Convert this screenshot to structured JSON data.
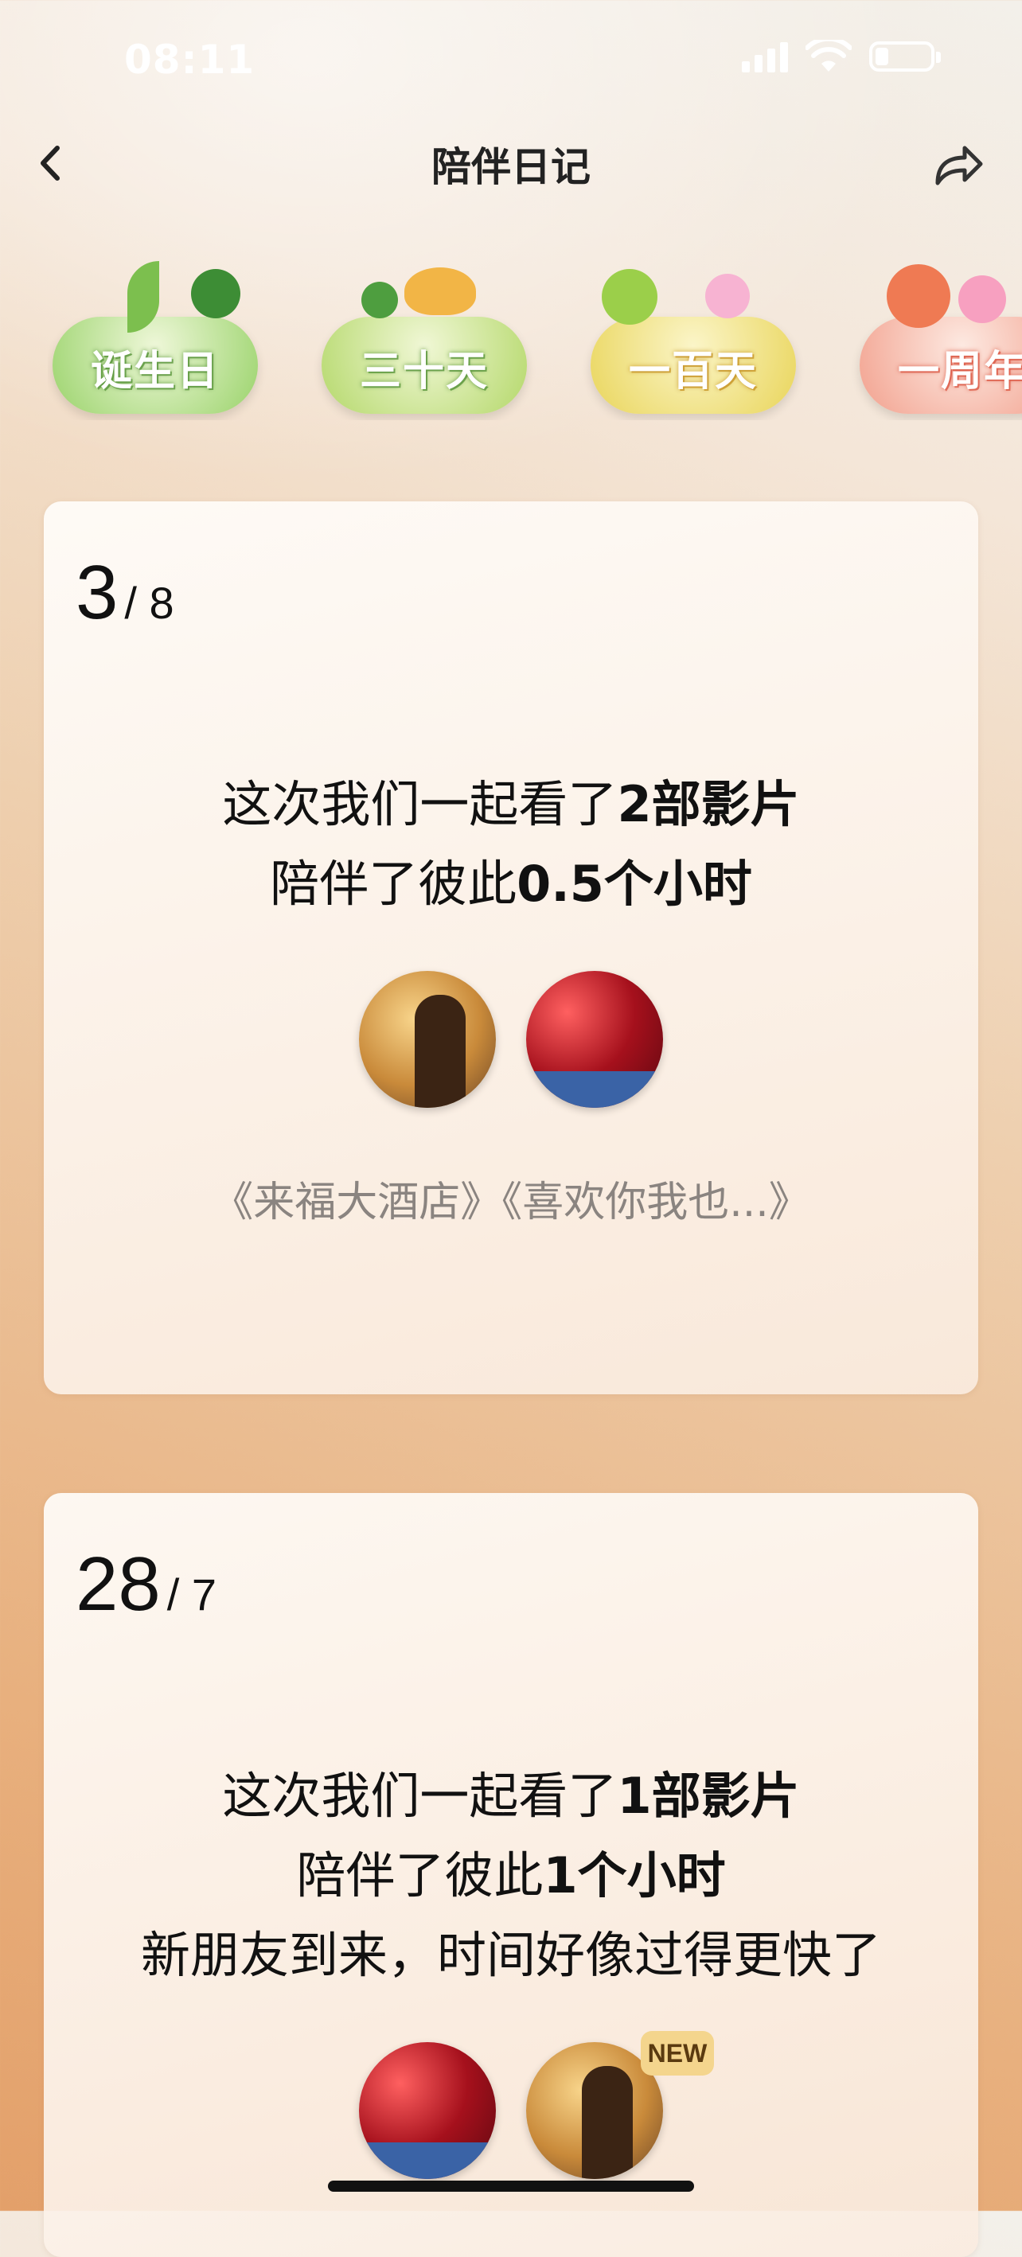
{
  "status_bar": {
    "time": "08:11"
  },
  "header": {
    "title": "陪伴日记"
  },
  "milestones": [
    {
      "label": "诞生日",
      "color": "#9ad36b"
    },
    {
      "label": "三十天",
      "color": "#b4d86a"
    },
    {
      "label": "一百天",
      "color": "#e9d55a"
    },
    {
      "label": "一周年",
      "color": "#f2a08d"
    }
  ],
  "cards": [
    {
      "day": "3",
      "month": "/ 8",
      "line1_pre": "这次我们一起看了",
      "line1_bold": "2部影片",
      "line2_pre": "陪伴了彼此",
      "line2_bold": "0.5个小时",
      "titles": "《来福大酒店》《喜欢你我也...》"
    },
    {
      "day": "28",
      "month": "/ 7",
      "line1_pre": "这次我们一起看了",
      "line1_bold": "1部影片",
      "line2_pre": "陪伴了彼此",
      "line2_bold": "1个小时",
      "line3": "新朋友到来，时间好像过得更快了",
      "new_tag": "NEW"
    }
  ]
}
